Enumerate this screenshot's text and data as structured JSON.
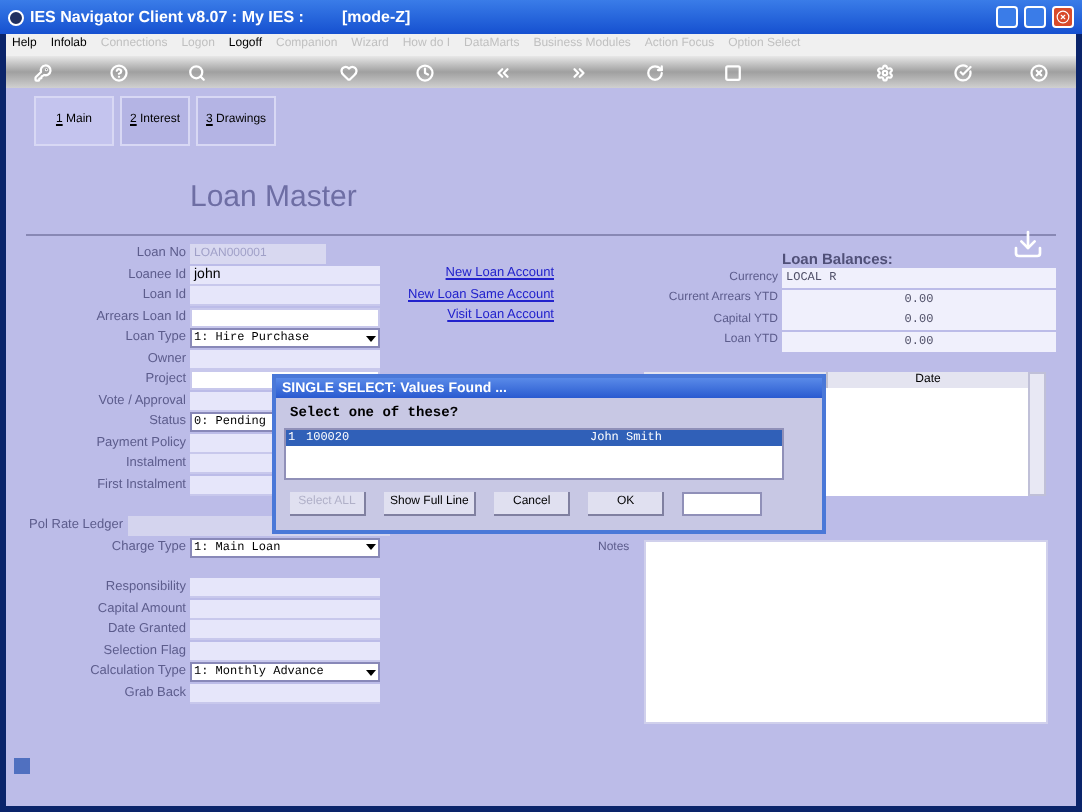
{
  "window": {
    "title": "IES Navigator Client v8.07 : My IES :",
    "mode": "[mode-Z]"
  },
  "menu": [
    {
      "label": "Help",
      "disabled": false
    },
    {
      "label": "Infolab",
      "disabled": false
    },
    {
      "label": "Connections",
      "disabled": true
    },
    {
      "label": "Logon",
      "disabled": true
    },
    {
      "label": "Logoff",
      "disabled": false
    },
    {
      "label": "Companion",
      "disabled": true
    },
    {
      "label": "Wizard",
      "disabled": true
    },
    {
      "label": "How do I",
      "disabled": true
    },
    {
      "label": "DataMarts",
      "disabled": true
    },
    {
      "label": "Business Modules",
      "disabled": true
    },
    {
      "label": "Action Focus",
      "disabled": true
    },
    {
      "label": "Option Select",
      "disabled": true
    }
  ],
  "tabs": [
    {
      "key": "1",
      "label": "Main",
      "selected": true
    },
    {
      "key": "2",
      "label": "Interest",
      "selected": false
    },
    {
      "key": "3",
      "label": "Drawings",
      "selected": false
    }
  ],
  "heading": "Loan Master",
  "form_groups": [
    [
      {
        "label": "Loan No",
        "kind": "short",
        "value": "LOAN000001"
      },
      {
        "label": "Loanee Id",
        "kind": "text",
        "value": "john"
      },
      {
        "label": "Loan Id",
        "kind": "text"
      },
      {
        "label": "Arrears Loan Id",
        "kind": "blank"
      },
      {
        "label": "Loan Type",
        "kind": "select",
        "value": "1: Hire Purchase"
      },
      {
        "label": "Owner",
        "kind": "text"
      },
      {
        "label": "Project",
        "kind": "blank"
      },
      {
        "label": "Vote / Approval",
        "kind": "text"
      },
      {
        "label": "Status",
        "kind": "select_cut",
        "value": "0: Pending"
      },
      {
        "label": "Payment Policy",
        "kind": "text"
      },
      {
        "label": "Instalment",
        "kind": "text"
      },
      {
        "label": "First Instalment",
        "kind": "text"
      }
    ],
    [
      {
        "label": "Pol Rate Ledger",
        "kind": "wide"
      },
      {
        "label": "Charge Type",
        "kind": "select",
        "value": "1: Main Loan"
      }
    ],
    [
      {
        "label": "Responsibility",
        "kind": "text"
      },
      {
        "label": "Capital Amount",
        "kind": "text"
      },
      {
        "label": "Date Granted",
        "kind": "text"
      },
      {
        "label": "Selection Flag",
        "kind": "text"
      },
      {
        "label": "Calculation Type",
        "kind": "select",
        "value": "1: Monthly Advance"
      },
      {
        "label": "Grab Back",
        "kind": "text"
      }
    ]
  ],
  "links": [
    "New Loan Account",
    "New Loan Same Account",
    "Visit Loan Account"
  ],
  "balances": {
    "title": "Loan Balances:",
    "rows": [
      {
        "label": "Currency",
        "value": "LOCAL R",
        "kind": "text"
      },
      {
        "label": "Current Arrears YTD",
        "value": "0.00",
        "kind": "amount"
      },
      {
        "label": "Capital YTD",
        "value": "0.00",
        "kind": "amount"
      },
      {
        "label": "Loan YTD",
        "value": "0.00",
        "kind": "amount"
      }
    ]
  },
  "table": {
    "columns": [
      "Date"
    ]
  },
  "notes": {
    "label": "Notes"
  },
  "dialog": {
    "title": "SINGLE SELECT: Values Found ...",
    "prompt": "Select one of these?",
    "rows": [
      {
        "cells": [
          "1",
          "100020",
          "John Smith"
        ],
        "selected": true
      }
    ],
    "buttons": [
      {
        "label": "Select ALL",
        "disabled": true
      },
      {
        "label": "Show Full Line",
        "disabled": false
      },
      {
        "label": "Cancel",
        "disabled": false
      },
      {
        "label": "OK",
        "disabled": false
      }
    ]
  }
}
